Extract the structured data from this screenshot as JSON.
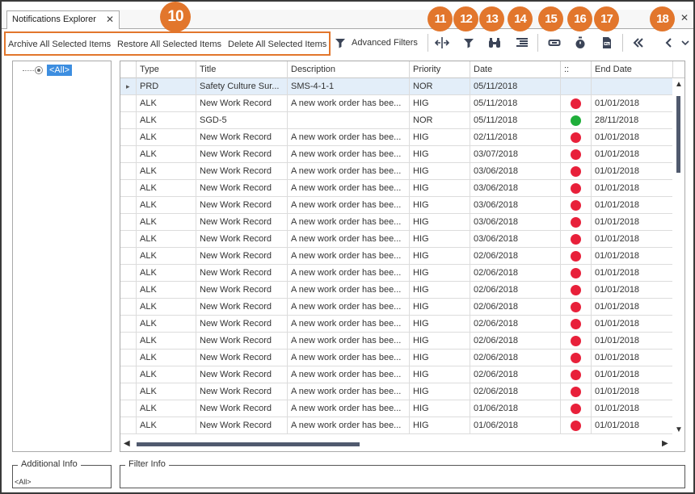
{
  "tab": {
    "title": "Notifications Explorer",
    "close": "✕"
  },
  "window": {
    "close": "✕"
  },
  "toolbar": {
    "archive_label": "Archive All Selected Items",
    "restore_label": "Restore All Selected Items",
    "delete_label": "Delete All Selected Items",
    "advanced_filters_label": "Advanced Filters",
    "buttons": [
      {
        "icon": "column-chooser-icon",
        "badge": "11"
      },
      {
        "icon": "filter-icon",
        "badge": "12"
      },
      {
        "icon": "binoculars-icon",
        "badge": "13"
      },
      {
        "icon": "row-list-icon",
        "badge": "14"
      },
      {
        "icon": "link-icon",
        "badge": "15"
      },
      {
        "icon": "stopwatch-icon",
        "badge": "16"
      },
      {
        "icon": "export-xls-icon",
        "badge": "17"
      },
      {
        "icon": "double-chevron-left-icon"
      },
      {
        "icon": "chevron-left-icon",
        "badge": "18"
      },
      {
        "icon": "chevron-down-icon"
      }
    ],
    "group_badge": "10"
  },
  "tree": {
    "root_label": "<All>"
  },
  "grid": {
    "columns": [
      "Type",
      "Title",
      "Description",
      "Priority",
      "Date",
      "::",
      "End Date"
    ],
    "rows": [
      {
        "type": "PRD",
        "title": "Safety Culture Sur...",
        "description": "SMS-4-1-1",
        "priority": "NOR",
        "date": "05/11/2018",
        "status": "",
        "end_date": ""
      },
      {
        "type": "ALK",
        "title": "New Work Record",
        "description": "A new work order has bee...",
        "priority": "HIG",
        "date": "05/11/2018",
        "status": "red",
        "end_date": "01/01/2018"
      },
      {
        "type": "ALK",
        "title": "SGD-5",
        "description": "",
        "priority": "NOR",
        "date": "05/11/2018",
        "status": "green",
        "end_date": "28/11/2018"
      },
      {
        "type": "ALK",
        "title": "New Work Record",
        "description": "A new work order has bee...",
        "priority": "HIG",
        "date": "02/11/2018",
        "status": "red",
        "end_date": "01/01/2018"
      },
      {
        "type": "ALK",
        "title": "New Work Record",
        "description": "A new work order has bee...",
        "priority": "HIG",
        "date": "03/07/2018",
        "status": "red",
        "end_date": "01/01/2018"
      },
      {
        "type": "ALK",
        "title": "New Work Record",
        "description": "A new work order has bee...",
        "priority": "HIG",
        "date": "03/06/2018",
        "status": "red",
        "end_date": "01/01/2018"
      },
      {
        "type": "ALK",
        "title": "New Work Record",
        "description": "A new work order has bee...",
        "priority": "HIG",
        "date": "03/06/2018",
        "status": "red",
        "end_date": "01/01/2018"
      },
      {
        "type": "ALK",
        "title": "New Work Record",
        "description": "A new work order has bee...",
        "priority": "HIG",
        "date": "03/06/2018",
        "status": "red",
        "end_date": "01/01/2018"
      },
      {
        "type": "ALK",
        "title": "New Work Record",
        "description": "A new work order has bee...",
        "priority": "HIG",
        "date": "03/06/2018",
        "status": "red",
        "end_date": "01/01/2018"
      },
      {
        "type": "ALK",
        "title": "New Work Record",
        "description": "A new work order has bee...",
        "priority": "HIG",
        "date": "03/06/2018",
        "status": "red",
        "end_date": "01/01/2018"
      },
      {
        "type": "ALK",
        "title": "New Work Record",
        "description": "A new work order has bee...",
        "priority": "HIG",
        "date": "02/06/2018",
        "status": "red",
        "end_date": "01/01/2018"
      },
      {
        "type": "ALK",
        "title": "New Work Record",
        "description": "A new work order has bee...",
        "priority": "HIG",
        "date": "02/06/2018",
        "status": "red",
        "end_date": "01/01/2018"
      },
      {
        "type": "ALK",
        "title": "New Work Record",
        "description": "A new work order has bee...",
        "priority": "HIG",
        "date": "02/06/2018",
        "status": "red",
        "end_date": "01/01/2018"
      },
      {
        "type": "ALK",
        "title": "New Work Record",
        "description": "A new work order has bee...",
        "priority": "HIG",
        "date": "02/06/2018",
        "status": "red",
        "end_date": "01/01/2018"
      },
      {
        "type": "ALK",
        "title": "New Work Record",
        "description": "A new work order has bee...",
        "priority": "HIG",
        "date": "02/06/2018",
        "status": "red",
        "end_date": "01/01/2018"
      },
      {
        "type": "ALK",
        "title": "New Work Record",
        "description": "A new work order has bee...",
        "priority": "HIG",
        "date": "02/06/2018",
        "status": "red",
        "end_date": "01/01/2018"
      },
      {
        "type": "ALK",
        "title": "New Work Record",
        "description": "A new work order has bee...",
        "priority": "HIG",
        "date": "02/06/2018",
        "status": "red",
        "end_date": "01/01/2018"
      },
      {
        "type": "ALK",
        "title": "New Work Record",
        "description": "A new work order has bee...",
        "priority": "HIG",
        "date": "02/06/2018",
        "status": "red",
        "end_date": "01/01/2018"
      },
      {
        "type": "ALK",
        "title": "New Work Record",
        "description": "A new work order has bee...",
        "priority": "HIG",
        "date": "02/06/2018",
        "status": "red",
        "end_date": "01/01/2018"
      },
      {
        "type": "ALK",
        "title": "New Work Record",
        "description": "A new work order has bee...",
        "priority": "HIG",
        "date": "01/06/2018",
        "status": "red",
        "end_date": "01/01/2018"
      },
      {
        "type": "ALK",
        "title": "New Work Record",
        "description": "A new work order has bee...",
        "priority": "HIG",
        "date": "01/06/2018",
        "status": "red",
        "end_date": "01/01/2018"
      }
    ]
  },
  "additional_info": {
    "title": "Additional Info",
    "value": "<All>"
  },
  "filter_info": {
    "title": "Filter Info"
  },
  "colors": {
    "accent": "#e2762c",
    "status_red": "#e8203a",
    "status_green": "#1fae3a",
    "selection": "#3d8ee0"
  }
}
